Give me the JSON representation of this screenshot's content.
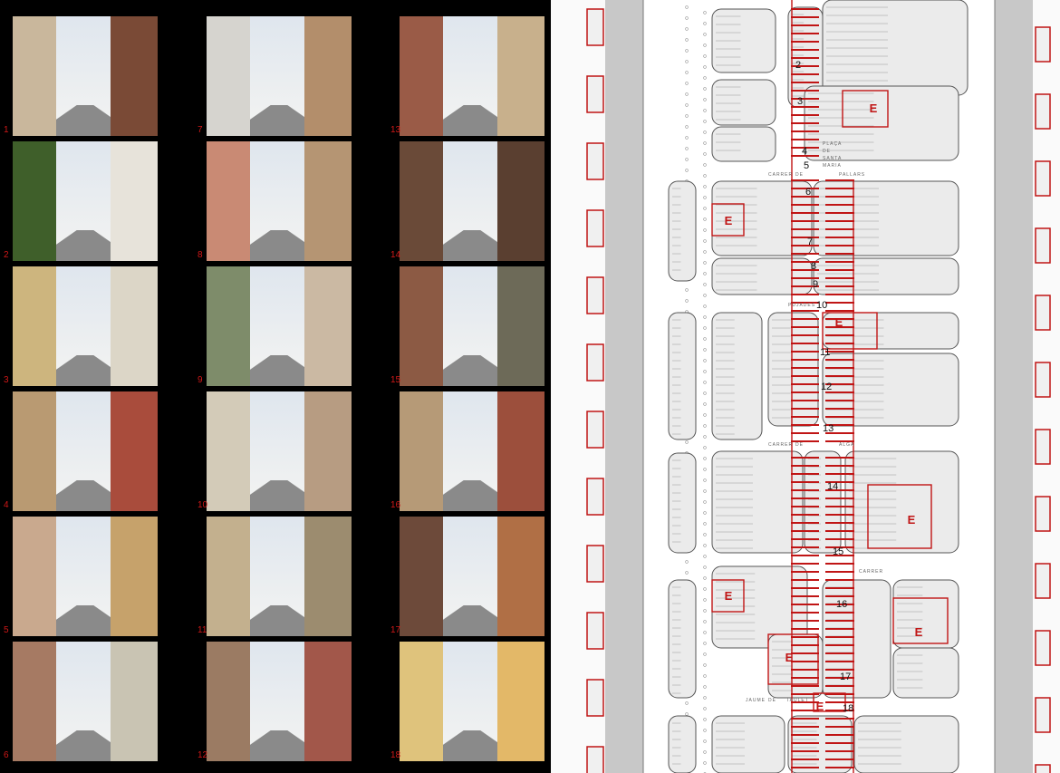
{
  "photos": [
    {
      "n": "1",
      "left": "#c9b79c",
      "right": "#7a4a36"
    },
    {
      "n": "2",
      "left": "#3f5f2a",
      "right": "#e7e3da"
    },
    {
      "n": "3",
      "left": "#cdb57e",
      "right": "#dcd6c7"
    },
    {
      "n": "4",
      "left": "#b99a72",
      "right": "#a94c3c"
    },
    {
      "n": "5",
      "left": "#c9a98e",
      "right": "#c6a26b"
    },
    {
      "n": "6",
      "left": "#a67a63",
      "right": "#c9c4b3"
    },
    {
      "n": "7",
      "left": "#d6d4cf",
      "right": "#b38e6b"
    },
    {
      "n": "8",
      "left": "#c98a74",
      "right": "#b59573"
    },
    {
      "n": "9",
      "left": "#7e8c6a",
      "right": "#cbb9a3"
    },
    {
      "n": "10",
      "left": "#d3cbb8",
      "right": "#b79c82"
    },
    {
      "n": "11",
      "left": "#c3b08e",
      "right": "#9c8c6f"
    },
    {
      "n": "12",
      "left": "#9b7b63",
      "right": "#a2574a"
    },
    {
      "n": "13",
      "left": "#9a5b47",
      "right": "#c8b08c"
    },
    {
      "n": "14",
      "left": "#6a4a38",
      "right": "#5a3f30"
    },
    {
      "n": "15",
      "left": "#8c5a44",
      "right": "#6d6a58"
    },
    {
      "n": "16",
      "left": "#b69a77",
      "right": "#9c4f3c"
    },
    {
      "n": "17",
      "left": "#6d4a3a",
      "right": "#b06f45"
    },
    {
      "n": "18",
      "left": "#dfc37c",
      "right": "#e3b868"
    }
  ],
  "plan": {
    "points": [
      {
        "n": "2"
      },
      {
        "n": "3"
      },
      {
        "n": "4"
      },
      {
        "n": "5"
      },
      {
        "n": "6"
      },
      {
        "n": "7"
      },
      {
        "n": "8"
      },
      {
        "n": "9"
      },
      {
        "n": "10"
      },
      {
        "n": "11"
      },
      {
        "n": "12"
      },
      {
        "n": "13"
      },
      {
        "n": "14"
      },
      {
        "n": "15"
      },
      {
        "n": "16"
      },
      {
        "n": "17"
      },
      {
        "n": "18"
      }
    ],
    "equipment_label": "E",
    "street_labels": [
      "CARRER",
      "DE",
      "PALLARS",
      "PUJADES",
      "CARRER",
      "DE",
      "ALGA",
      "CARRER",
      "JAUME",
      "DE",
      "TAULET",
      "PLAÇA",
      "DE",
      "SANTA",
      "MARIA"
    ]
  },
  "colors": {
    "accent": "#c01515",
    "block": "#ebebeb",
    "outline": "#555555"
  }
}
